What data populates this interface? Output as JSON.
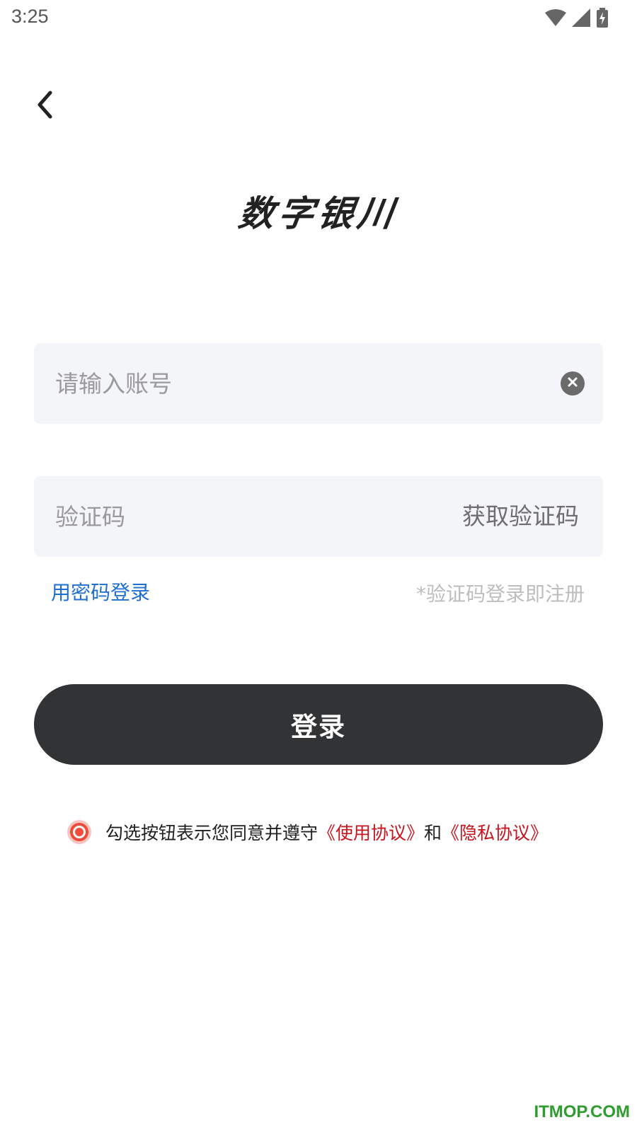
{
  "status_bar": {
    "time": "3:25",
    "icons": [
      "wifi-icon",
      "cellular-signal-icon",
      "battery-charging-icon"
    ]
  },
  "nav": {
    "back_icon": "chevron-left-icon"
  },
  "app": {
    "logo_text": "数字银川"
  },
  "form": {
    "account": {
      "placeholder": "请输入账号",
      "value": "",
      "clear_icon": "clear-circle-icon"
    },
    "code": {
      "placeholder": "验证码",
      "value": "",
      "get_code_label": "获取验证码"
    },
    "password_login_label": "用密码登录",
    "register_hint": "*验证码登录即注册",
    "login_label": "登录"
  },
  "agreement": {
    "text_before": "勾选按钮表示您同意并遵守",
    "terms_link": "《使用协议》",
    "and_text": "和",
    "privacy_link": "《隐私协议》",
    "checked": true
  },
  "watermark": "ITMOP.COM",
  "colors": {
    "accent_link": "#1e6fd1",
    "agreement_link": "#c8141e",
    "login_button_bg": "#323335",
    "field_bg": "#f4f5f9",
    "radio_accent": "#ef4b3a",
    "watermark": "#2f9c2f"
  }
}
